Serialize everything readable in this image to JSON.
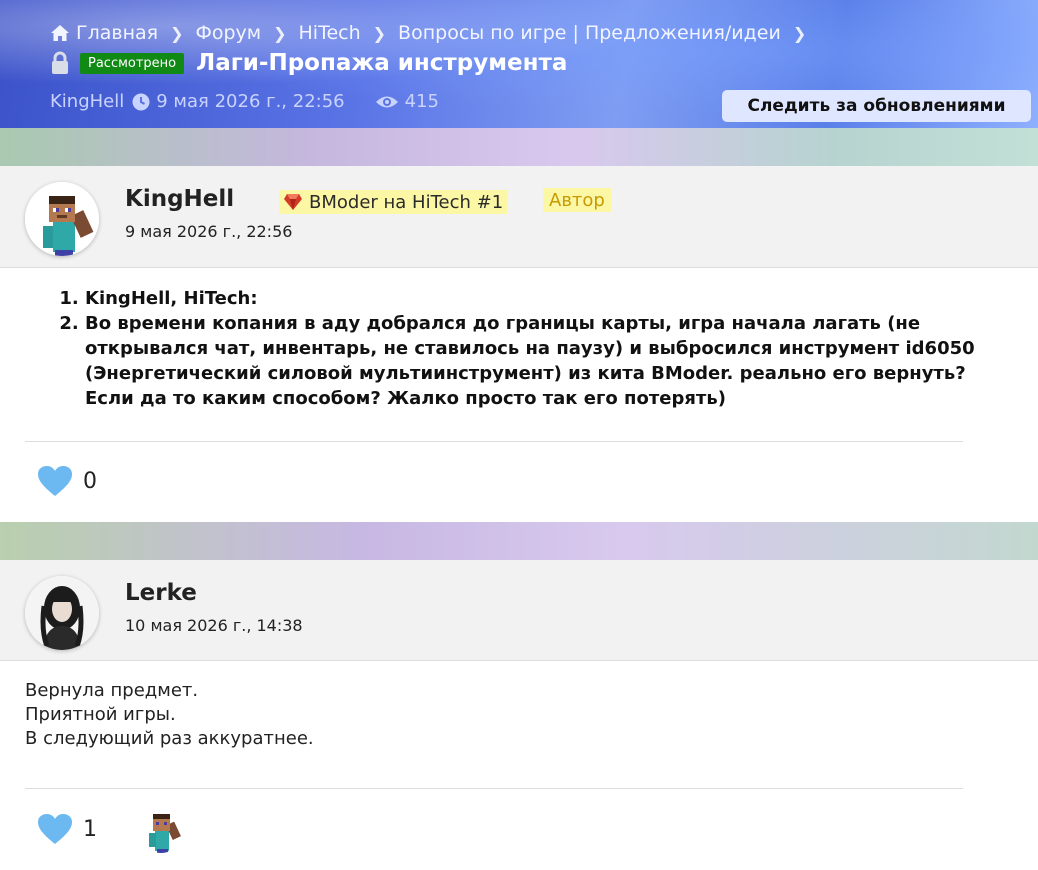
{
  "breadcrumb": {
    "items": [
      "Главная",
      "Форум",
      "HiTech",
      "Вопросы по игре | Предложения/идеи"
    ]
  },
  "thread": {
    "status": "Рассмотрено",
    "title": "Лаги-Пропажа инструмента",
    "author": "KingHell",
    "date": "9 мая 2026 г., 22:56",
    "views": "415",
    "follow_label": "Следить за обновлениями"
  },
  "posts": [
    {
      "username": "KingHell",
      "date": "9 мая 2026 г., 22:56",
      "rank": "BModer на HiTech #1",
      "author_badge": "Автор",
      "list": [
        "KingHell, HiTech:",
        "Во времени копания в аду добрался до границы карты, игра начала лагать (не открывался чат, инвентарь, не ставилось на паузу) и выбросился инструмент id6050 (Энергетический силовой мультиинструмент) из кита BModer. реально его вернуть? Если да то каким способом? Жалко просто так его потерять)"
      ],
      "likes": "0"
    },
    {
      "username": "Lerke",
      "date": "10 мая 2026 г., 14:38",
      "lines": [
        "Вернула предмет.",
        "Приятной игры.",
        "В следующий раз аккуратнее."
      ],
      "likes": "1"
    }
  ],
  "colors": {
    "status_green": "#108a14",
    "heart_blue": "#6cb8f0",
    "badge_yellow": "#fbf7a5"
  }
}
